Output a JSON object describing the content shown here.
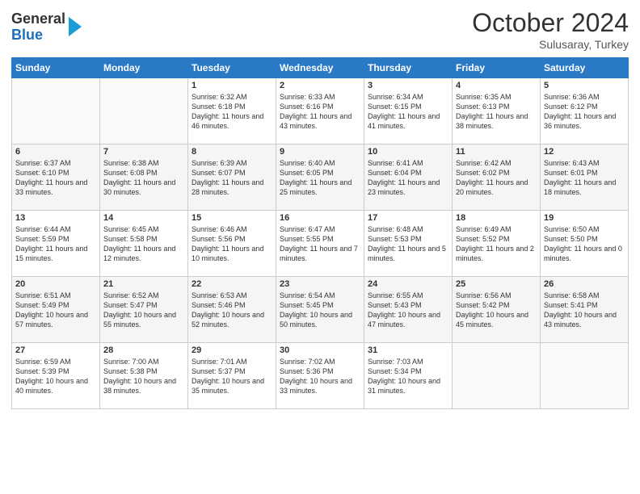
{
  "header": {
    "logo_line1": "General",
    "logo_line2": "Blue",
    "month_year": "October 2024",
    "location": "Sulusaray, Turkey"
  },
  "weekdays": [
    "Sunday",
    "Monday",
    "Tuesday",
    "Wednesday",
    "Thursday",
    "Friday",
    "Saturday"
  ],
  "weeks": [
    [
      {
        "day": "",
        "sunrise": "",
        "sunset": "",
        "daylight": ""
      },
      {
        "day": "",
        "sunrise": "",
        "sunset": "",
        "daylight": ""
      },
      {
        "day": "1",
        "sunrise": "Sunrise: 6:32 AM",
        "sunset": "Sunset: 6:18 PM",
        "daylight": "Daylight: 11 hours and 46 minutes."
      },
      {
        "day": "2",
        "sunrise": "Sunrise: 6:33 AM",
        "sunset": "Sunset: 6:16 PM",
        "daylight": "Daylight: 11 hours and 43 minutes."
      },
      {
        "day": "3",
        "sunrise": "Sunrise: 6:34 AM",
        "sunset": "Sunset: 6:15 PM",
        "daylight": "Daylight: 11 hours and 41 minutes."
      },
      {
        "day": "4",
        "sunrise": "Sunrise: 6:35 AM",
        "sunset": "Sunset: 6:13 PM",
        "daylight": "Daylight: 11 hours and 38 minutes."
      },
      {
        "day": "5",
        "sunrise": "Sunrise: 6:36 AM",
        "sunset": "Sunset: 6:12 PM",
        "daylight": "Daylight: 11 hours and 36 minutes."
      }
    ],
    [
      {
        "day": "6",
        "sunrise": "Sunrise: 6:37 AM",
        "sunset": "Sunset: 6:10 PM",
        "daylight": "Daylight: 11 hours and 33 minutes."
      },
      {
        "day": "7",
        "sunrise": "Sunrise: 6:38 AM",
        "sunset": "Sunset: 6:08 PM",
        "daylight": "Daylight: 11 hours and 30 minutes."
      },
      {
        "day": "8",
        "sunrise": "Sunrise: 6:39 AM",
        "sunset": "Sunset: 6:07 PM",
        "daylight": "Daylight: 11 hours and 28 minutes."
      },
      {
        "day": "9",
        "sunrise": "Sunrise: 6:40 AM",
        "sunset": "Sunset: 6:05 PM",
        "daylight": "Daylight: 11 hours and 25 minutes."
      },
      {
        "day": "10",
        "sunrise": "Sunrise: 6:41 AM",
        "sunset": "Sunset: 6:04 PM",
        "daylight": "Daylight: 11 hours and 23 minutes."
      },
      {
        "day": "11",
        "sunrise": "Sunrise: 6:42 AM",
        "sunset": "Sunset: 6:02 PM",
        "daylight": "Daylight: 11 hours and 20 minutes."
      },
      {
        "day": "12",
        "sunrise": "Sunrise: 6:43 AM",
        "sunset": "Sunset: 6:01 PM",
        "daylight": "Daylight: 11 hours and 18 minutes."
      }
    ],
    [
      {
        "day": "13",
        "sunrise": "Sunrise: 6:44 AM",
        "sunset": "Sunset: 5:59 PM",
        "daylight": "Daylight: 11 hours and 15 minutes."
      },
      {
        "day": "14",
        "sunrise": "Sunrise: 6:45 AM",
        "sunset": "Sunset: 5:58 PM",
        "daylight": "Daylight: 11 hours and 12 minutes."
      },
      {
        "day": "15",
        "sunrise": "Sunrise: 6:46 AM",
        "sunset": "Sunset: 5:56 PM",
        "daylight": "Daylight: 11 hours and 10 minutes."
      },
      {
        "day": "16",
        "sunrise": "Sunrise: 6:47 AM",
        "sunset": "Sunset: 5:55 PM",
        "daylight": "Daylight: 11 hours and 7 minutes."
      },
      {
        "day": "17",
        "sunrise": "Sunrise: 6:48 AM",
        "sunset": "Sunset: 5:53 PM",
        "daylight": "Daylight: 11 hours and 5 minutes."
      },
      {
        "day": "18",
        "sunrise": "Sunrise: 6:49 AM",
        "sunset": "Sunset: 5:52 PM",
        "daylight": "Daylight: 11 hours and 2 minutes."
      },
      {
        "day": "19",
        "sunrise": "Sunrise: 6:50 AM",
        "sunset": "Sunset: 5:50 PM",
        "daylight": "Daylight: 11 hours and 0 minutes."
      }
    ],
    [
      {
        "day": "20",
        "sunrise": "Sunrise: 6:51 AM",
        "sunset": "Sunset: 5:49 PM",
        "daylight": "Daylight: 10 hours and 57 minutes."
      },
      {
        "day": "21",
        "sunrise": "Sunrise: 6:52 AM",
        "sunset": "Sunset: 5:47 PM",
        "daylight": "Daylight: 10 hours and 55 minutes."
      },
      {
        "day": "22",
        "sunrise": "Sunrise: 6:53 AM",
        "sunset": "Sunset: 5:46 PM",
        "daylight": "Daylight: 10 hours and 52 minutes."
      },
      {
        "day": "23",
        "sunrise": "Sunrise: 6:54 AM",
        "sunset": "Sunset: 5:45 PM",
        "daylight": "Daylight: 10 hours and 50 minutes."
      },
      {
        "day": "24",
        "sunrise": "Sunrise: 6:55 AM",
        "sunset": "Sunset: 5:43 PM",
        "daylight": "Daylight: 10 hours and 47 minutes."
      },
      {
        "day": "25",
        "sunrise": "Sunrise: 6:56 AM",
        "sunset": "Sunset: 5:42 PM",
        "daylight": "Daylight: 10 hours and 45 minutes."
      },
      {
        "day": "26",
        "sunrise": "Sunrise: 6:58 AM",
        "sunset": "Sunset: 5:41 PM",
        "daylight": "Daylight: 10 hours and 43 minutes."
      }
    ],
    [
      {
        "day": "27",
        "sunrise": "Sunrise: 6:59 AM",
        "sunset": "Sunset: 5:39 PM",
        "daylight": "Daylight: 10 hours and 40 minutes."
      },
      {
        "day": "28",
        "sunrise": "Sunrise: 7:00 AM",
        "sunset": "Sunset: 5:38 PM",
        "daylight": "Daylight: 10 hours and 38 minutes."
      },
      {
        "day": "29",
        "sunrise": "Sunrise: 7:01 AM",
        "sunset": "Sunset: 5:37 PM",
        "daylight": "Daylight: 10 hours and 35 minutes."
      },
      {
        "day": "30",
        "sunrise": "Sunrise: 7:02 AM",
        "sunset": "Sunset: 5:36 PM",
        "daylight": "Daylight: 10 hours and 33 minutes."
      },
      {
        "day": "31",
        "sunrise": "Sunrise: 7:03 AM",
        "sunset": "Sunset: 5:34 PM",
        "daylight": "Daylight: 10 hours and 31 minutes."
      },
      {
        "day": "",
        "sunrise": "",
        "sunset": "",
        "daylight": ""
      },
      {
        "day": "",
        "sunrise": "",
        "sunset": "",
        "daylight": ""
      }
    ]
  ]
}
